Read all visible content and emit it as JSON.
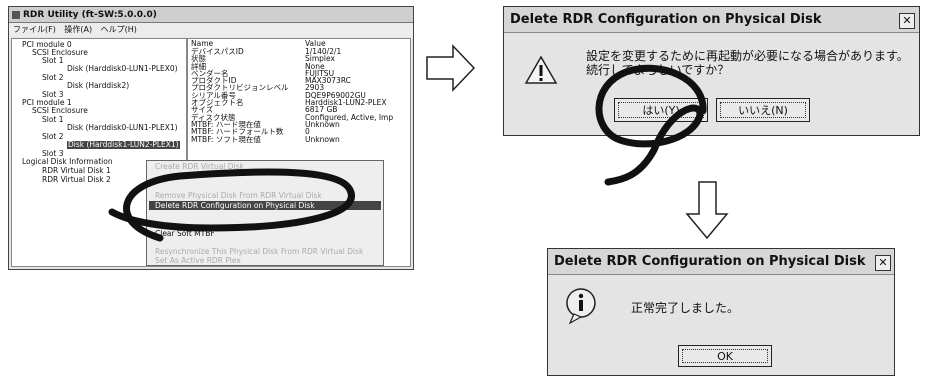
{
  "main_window": {
    "title": "RDR Utility (ft-SW:5.0.0.0)",
    "menu": [
      "ファイル(F)",
      "操作(A)",
      "ヘルプ(H)"
    ],
    "tree": [
      "PCI module 0",
      "SCSI Enclosure",
      "Slot 1",
      "Disk (Harddisk0-LUN1-PLEX0)",
      "Slot 2",
      "Disk (Harddisk2)",
      "Slot 3",
      "PCI module 1",
      "SCSI Enclosure",
      "Slot 1",
      "Disk (Harddisk0-LUN1-PLEX1)",
      "Slot 2",
      "Disk (Harddisk1-LUN2-PLEX1)",
      "Slot 3",
      "Logical Disk Information",
      "RDR Virtual Disk 1",
      "RDR Virtual Disk 2"
    ],
    "props_header": {
      "name": "Name",
      "value": "Value"
    },
    "props": [
      {
        "name": "デバイスパスID",
        "value": "1/140/2/1"
      },
      {
        "name": "状態",
        "value": "Simplex"
      },
      {
        "name": "詳細",
        "value": "None"
      },
      {
        "name": "ベンダー名",
        "value": "FUJITSU"
      },
      {
        "name": "プロダクトID",
        "value": "MAX3073RC"
      },
      {
        "name": "プロダクトリビジョンレベル",
        "value": "2903"
      },
      {
        "name": "シリアル番号",
        "value": "DQE9P69002GU"
      },
      {
        "name": "オブジェクト名",
        "value": "Harddisk1-LUN2-PLEX"
      },
      {
        "name": "サイズ",
        "value": "6817 GB"
      },
      {
        "name": "ディスク状態",
        "value": "Configured, Active, Imp"
      },
      {
        "name": "MTBF: ハード現在値",
        "value": "Unknown"
      },
      {
        "name": "MTBF: ハードフォールト数",
        "value": "0"
      },
      {
        "name": "MTBF: ソフト現在値",
        "value": "Unknown"
      }
    ]
  },
  "context_menu": [
    {
      "label": "Create RDR Virtual Disk",
      "enabled": false
    },
    {
      "label": "Remove Physical Disk From RDR Virtual Disk",
      "enabled": false
    },
    {
      "label": "Delete RDR Configuration on Physical Disk",
      "enabled": true,
      "selected": true
    },
    {
      "label": "Clear Soft MTBF",
      "enabled": true
    },
    {
      "label": "Resynchronize This Physical Disk From RDR Virtual Disk",
      "enabled": false
    },
    {
      "label": "Set As Active RDR Plex",
      "enabled": false
    }
  ],
  "confirm_dialog": {
    "title": "Delete RDR Configuration on Physical Disk",
    "close": "✕",
    "icon": "warning-icon",
    "message_line1": "設定を変更するために再起動が必要になる場合があります。",
    "message_line2": "続行してよろしいですか？",
    "yes": "はい(Y)",
    "no": "いいえ(N)"
  },
  "done_dialog": {
    "title": "Delete RDR Configuration on Physical Disk",
    "close": "✕",
    "icon": "info-icon",
    "message": "正常完了しました。",
    "ok": "OK"
  }
}
